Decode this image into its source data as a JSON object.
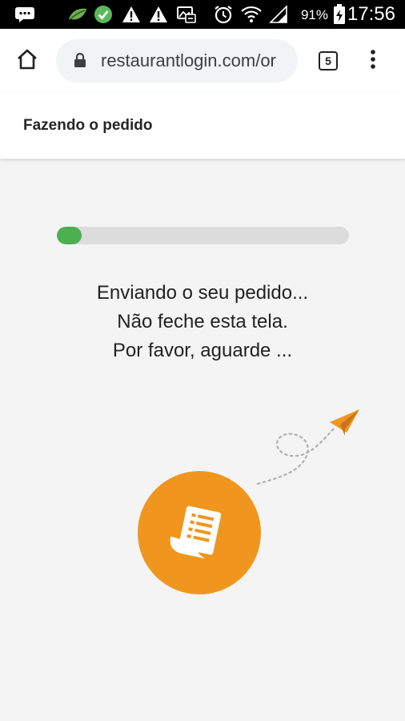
{
  "status_bar": {
    "battery_percent": "91%",
    "time": "17:56",
    "icons": [
      "chat-icon",
      "leaf-icon",
      "check-circle-icon",
      "warning-icon",
      "warning-icon",
      "image-icon",
      "alarm-icon",
      "wifi-icon",
      "signal-icon",
      "battery-charging-icon"
    ]
  },
  "browser": {
    "url": "restaurantlogin.com/or",
    "tab_count": "5",
    "icons": [
      "home-icon",
      "lock-icon",
      "tabs-icon",
      "more-vert-icon"
    ]
  },
  "page": {
    "title": "Fazendo o pedido"
  },
  "progress": {
    "fraction": 0.085,
    "color": "#4caf50"
  },
  "message": {
    "line1": "Enviando o seu pedido...",
    "line2": "Não feche esta tela.",
    "line3": "Por favor, aguarde ..."
  },
  "illustration": {
    "accent_color": "#f0961e",
    "icons": [
      "paper-plane-icon",
      "receipt-icon"
    ]
  }
}
